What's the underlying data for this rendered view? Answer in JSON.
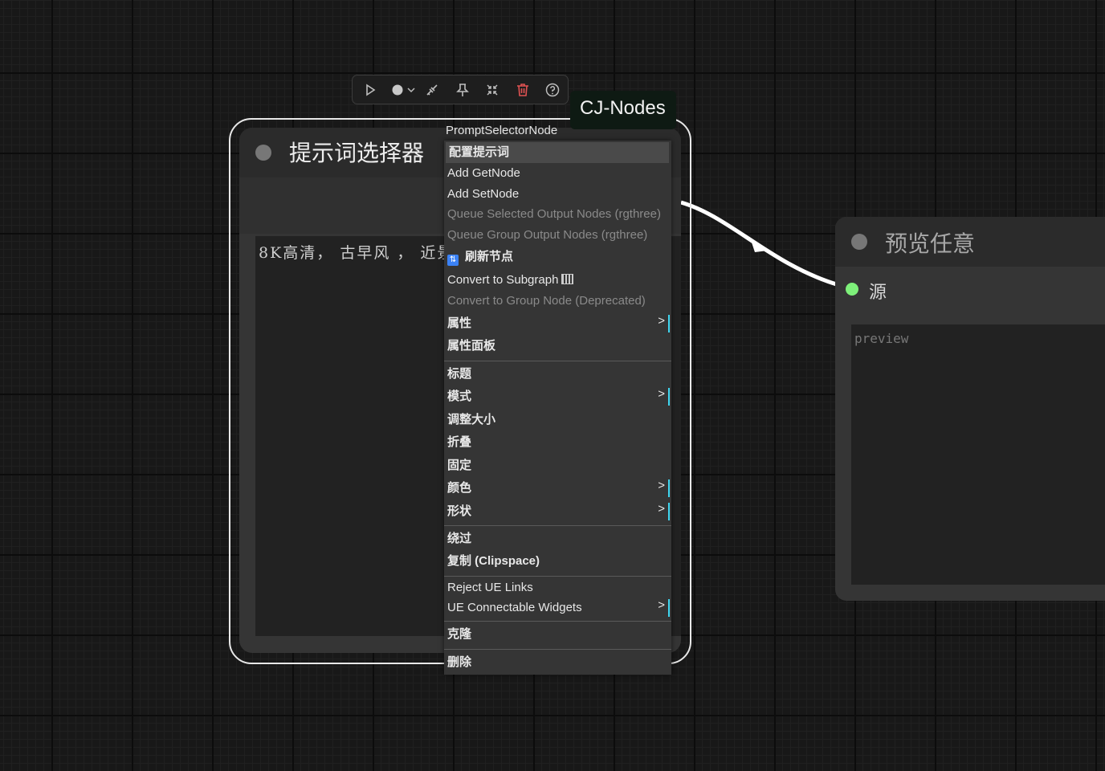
{
  "toolbar": {
    "icons": [
      "play-icon",
      "color-dot-icon",
      "chevron-down-icon",
      "bypass-icon",
      "pin-icon",
      "collapse-icon",
      "trash-icon",
      "help-icon"
    ],
    "trash_color": "#e05252"
  },
  "badge": {
    "label": "CJ-Nodes"
  },
  "node1": {
    "title": "提示词选择器",
    "text_value": "8K高清， 古早风 ， 近景"
  },
  "node2": {
    "title": "预览任意",
    "slot_label": "源",
    "placeholder": "preview",
    "slot_color": "#7ef07a"
  },
  "menu": {
    "title": "PromptSelectorNode",
    "items": [
      {
        "label": "配置提示词"
      },
      {
        "label": "Add GetNode"
      },
      {
        "label": "Add SetNode"
      },
      {
        "label": "Queue Selected Output Nodes (rgthree)"
      },
      {
        "label": "Queue Group Output Nodes (rgthree)"
      },
      {
        "label": "刷新节点"
      },
      {
        "label": "Convert to Subgraph"
      },
      {
        "label": "Convert to Group Node (Deprecated)"
      },
      {
        "label": "属性",
        "submenu": ">"
      },
      {
        "label": "属性面板"
      },
      {
        "label": "标题"
      },
      {
        "label": "模式",
        "submenu": ">"
      },
      {
        "label": "调整大小"
      },
      {
        "label": "折叠"
      },
      {
        "label": "固定"
      },
      {
        "label": "颜色",
        "submenu": ">"
      },
      {
        "label": "形状",
        "submenu": ">"
      },
      {
        "label": "绕过"
      },
      {
        "label": "复制 (Clipspace)"
      },
      {
        "label": "Reject UE Links"
      },
      {
        "label": "UE Connectable Widgets",
        "submenu": ">"
      },
      {
        "label": "克隆"
      },
      {
        "label": "删除"
      }
    ]
  }
}
